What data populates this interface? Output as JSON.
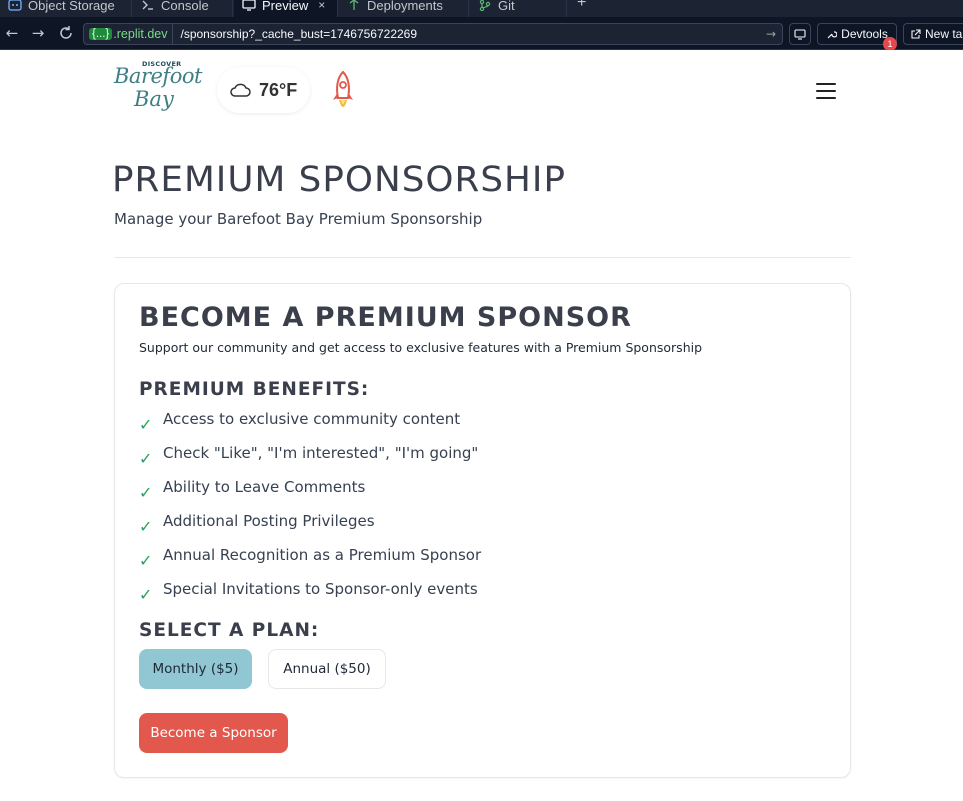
{
  "ide": {
    "tabs": [
      {
        "label": "Object Storage",
        "icon": "storage-icon",
        "active": false
      },
      {
        "label": "Console",
        "icon": "terminal-icon",
        "active": false
      },
      {
        "label": "Preview",
        "icon": "monitor-icon",
        "active": true
      },
      {
        "label": "Deployments",
        "icon": "deployments-icon",
        "active": false
      },
      {
        "label": "Git",
        "icon": "git-icon",
        "active": false
      }
    ],
    "add_tab": "+",
    "close_glyph": "×",
    "url": {
      "host_badge": "{...}",
      "host": ".replit.dev",
      "path": "/sponsorship?_cache_bust=1746756722269"
    },
    "devtools_label": "Devtools",
    "devtools_badge": "1",
    "new_tab_label": "New ta"
  },
  "header": {
    "logo_top": "DISCOVER",
    "logo_line1": "Barefoot",
    "logo_line2": "Bay",
    "weather_temp": "76°F"
  },
  "page": {
    "title": "PREMIUM SPONSORSHIP",
    "subtitle": "Manage your Barefoot Bay Premium Sponsorship"
  },
  "card": {
    "title": "BECOME A PREMIUM SPONSOR",
    "subtitle": "Support our community and get access to exclusive features with a Premium Sponsorship",
    "benefits_heading": "PREMIUM BENEFITS:",
    "check_glyph": "✓",
    "benefits": [
      "Access to exclusive community content",
      "Check \"Like\", \"I'm interested\", \"I'm going\"",
      "Ability to Leave Comments",
      "Additional Posting Privileges",
      "Annual Recognition as a Premium Sponsor",
      "Special Invitations to Sponsor-only events"
    ],
    "plan_heading": "SELECT A PLAN:",
    "plans": [
      {
        "label": "Monthly ($5)",
        "selected": true
      },
      {
        "label": "Annual ($50)",
        "selected": false
      }
    ],
    "cta_label": "Become a Sponsor"
  },
  "colors": {
    "accent_plan": "#90c7d2",
    "cta": "#e3584d",
    "check": "#22a55a",
    "ide_bg": "#0e1525"
  }
}
